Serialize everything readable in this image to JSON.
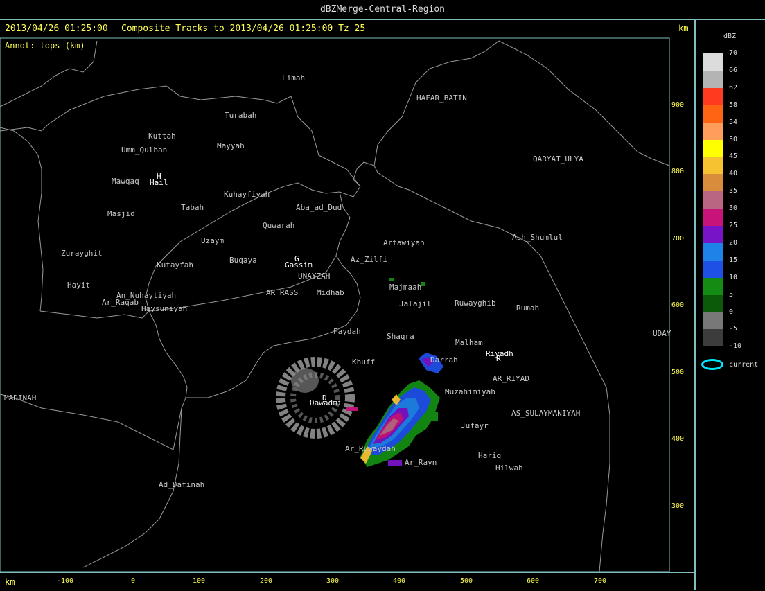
{
  "window": {
    "title": "dBZMerge-Central-Region"
  },
  "header": {
    "timestamp": "2013/04/26 01:25:00",
    "tracks_label": "Composite Tracks to 2013/04/26 01:25:00 Tz 25",
    "annot": "Annot: tops (km)",
    "unit_right": "km",
    "unit_bottom": "km"
  },
  "axes": {
    "x_ticks": [
      "-100",
      "0",
      "100",
      "200",
      "300",
      "400",
      "500",
      "600",
      "700"
    ],
    "y_ticks": [
      "900",
      "800",
      "700",
      "600",
      "500",
      "400",
      "300"
    ]
  },
  "places": [
    {
      "name": "Limah",
      "type": "label"
    },
    {
      "name": "HAFAR_BATIN",
      "type": "label"
    },
    {
      "name": "Turabah",
      "type": "label"
    },
    {
      "name": "Kuttah",
      "type": "label"
    },
    {
      "name": "Umm_Qulban",
      "type": "label"
    },
    {
      "name": "Mayyah",
      "type": "label"
    },
    {
      "name": "QARYAT_ULYA",
      "type": "label"
    },
    {
      "name": "Mawqaq",
      "type": "label"
    },
    {
      "name": "Hail",
      "type": "city"
    },
    {
      "name": "Kuhayfiyah",
      "type": "label"
    },
    {
      "name": "Tabah",
      "type": "label"
    },
    {
      "name": "Aba_ad_Dud",
      "type": "label"
    },
    {
      "name": "Masjid",
      "type": "label"
    },
    {
      "name": "Quwarah",
      "type": "label"
    },
    {
      "name": "Uzaym",
      "type": "label"
    },
    {
      "name": "Artawiyah",
      "type": "label"
    },
    {
      "name": "Ash_Shumlul",
      "type": "label"
    },
    {
      "name": "Zurayghit",
      "type": "label"
    },
    {
      "name": "Buqaya",
      "type": "label"
    },
    {
      "name": "Gassim",
      "type": "city"
    },
    {
      "name": "Az_Zilfi",
      "type": "label"
    },
    {
      "name": "Kutayfah",
      "type": "label"
    },
    {
      "name": "UNAYZAH",
      "type": "label"
    },
    {
      "name": "Hayit",
      "type": "label"
    },
    {
      "name": "Majmaah",
      "type": "label"
    },
    {
      "name": "An_Nuhaytiyah",
      "type": "label"
    },
    {
      "name": "AR_RASS",
      "type": "label"
    },
    {
      "name": "Midhab",
      "type": "label"
    },
    {
      "name": "Ar_Raqab",
      "type": "label"
    },
    {
      "name": "Jalajil",
      "type": "label"
    },
    {
      "name": "Ruwayghib",
      "type": "label"
    },
    {
      "name": "Haysuniyah",
      "type": "label"
    },
    {
      "name": "Rumah",
      "type": "label"
    },
    {
      "name": "Faydah",
      "type": "label"
    },
    {
      "name": "Shaqra",
      "type": "label"
    },
    {
      "name": "UDAY",
      "type": "label"
    },
    {
      "name": "Malham",
      "type": "label"
    },
    {
      "name": "Riyadh",
      "type": "city"
    },
    {
      "name": "Khuff",
      "type": "label"
    },
    {
      "name": "Darrah",
      "type": "label"
    },
    {
      "name": "AR_RIYAD",
      "type": "label"
    },
    {
      "name": "MADINAH",
      "type": "label"
    },
    {
      "name": "Dawadmi",
      "type": "city"
    },
    {
      "name": "Muzahimiyah",
      "type": "label"
    },
    {
      "name": "AS_SULAYMANIYAH",
      "type": "label"
    },
    {
      "name": "Jufayr",
      "type": "label"
    },
    {
      "name": "Ar_Ruwaydah",
      "type": "label"
    },
    {
      "name": "Hariq",
      "type": "label"
    },
    {
      "name": "Ar_Rayn",
      "type": "label"
    },
    {
      "name": "Hilwah",
      "type": "label"
    },
    {
      "name": "Ad_Dafinah",
      "type": "label"
    }
  ],
  "city_markers": [
    {
      "letter": "H",
      "city": "Hail"
    },
    {
      "letter": "G",
      "city": "Gassim"
    },
    {
      "letter": "R",
      "city": "Riyadh"
    },
    {
      "letter": "D",
      "city": "Dawadmi"
    }
  ],
  "legend": {
    "title": "dBZ",
    "entries": [
      {
        "value": "70",
        "color": "#dcdcdc"
      },
      {
        "value": "66",
        "color": "#b4b4b4"
      },
      {
        "value": "62",
        "color": "#ff3a1e"
      },
      {
        "value": "58",
        "color": "#ff6414"
      },
      {
        "value": "54",
        "color": "#ff9e5a"
      },
      {
        "value": "50",
        "color": "#ffff00"
      },
      {
        "value": "45",
        "color": "#f6c232"
      },
      {
        "value": "40",
        "color": "#d88c3c"
      },
      {
        "value": "35",
        "color": "#b96682"
      },
      {
        "value": "30",
        "color": "#c8147a"
      },
      {
        "value": "25",
        "color": "#7814c8"
      },
      {
        "value": "20",
        "color": "#1e82e6"
      },
      {
        "value": "15",
        "color": "#1e50e6"
      },
      {
        "value": "10",
        "color": "#148c14"
      },
      {
        "value": "5",
        "color": "#0a5a0a"
      },
      {
        "value": "0",
        "color": "#787878"
      },
      {
        "value": "-5",
        "color": "#3c3c3c"
      },
      {
        "value": "-10",
        "color": "#000000"
      }
    ],
    "current_label": "current",
    "current_color": "#00e5ff"
  },
  "colors": {
    "annotation_yellow": "#ffff55",
    "border": "#7fbfbf"
  }
}
